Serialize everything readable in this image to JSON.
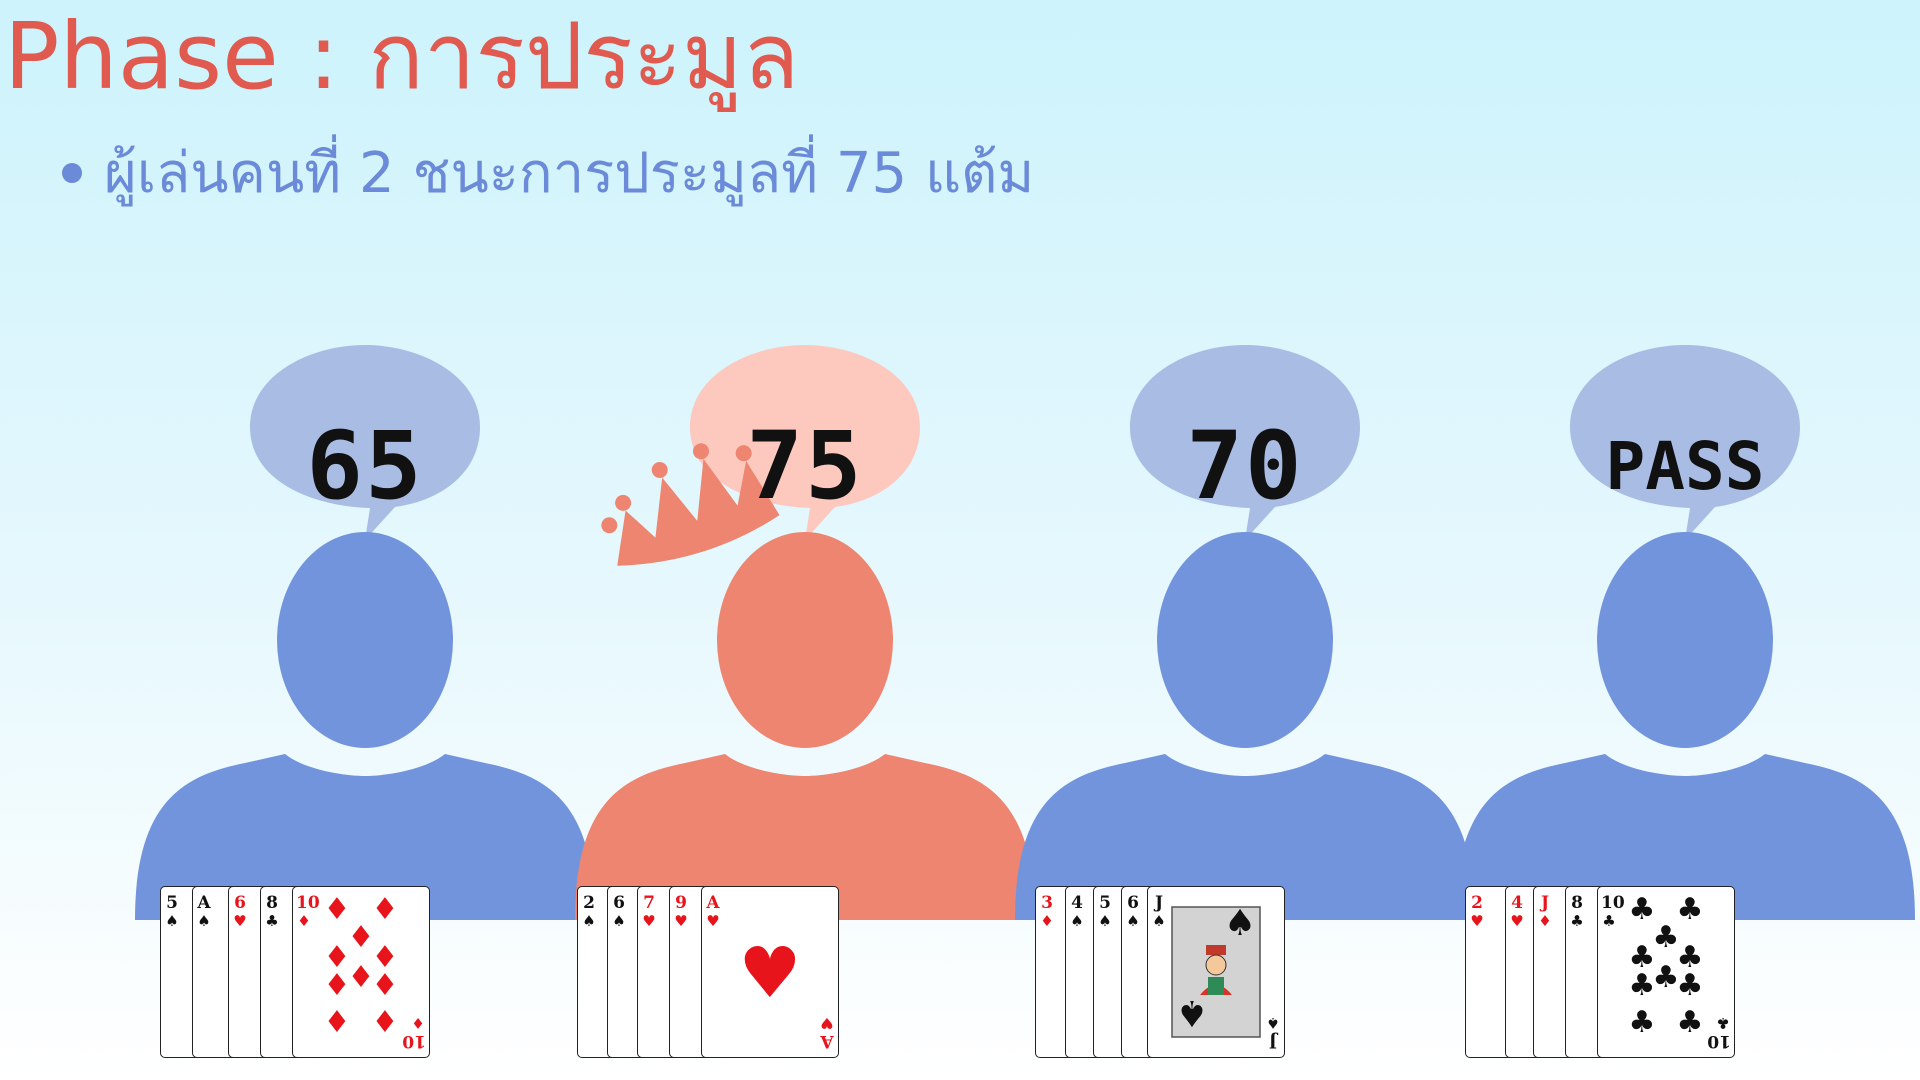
{
  "slide": {
    "title": "Phase : การประมูล",
    "bullet": "ผู้เล่นคนที่ 2 ชนะการประมูลที่ 75 แต้ม"
  },
  "colors": {
    "title": "#e05a4f",
    "bullet": "#6b8ad7",
    "player": "#7294dc",
    "winner": "#ee8570",
    "bubble": "#a9bce4",
    "winner_bubble": "#fdc9bf",
    "card_red": "#e8141c",
    "card_black": "#111111"
  },
  "players": [
    {
      "bid": "65",
      "winner": false,
      "cards": [
        {
          "rank": "5",
          "suit": "♠",
          "color": "black"
        },
        {
          "rank": "A",
          "suit": "♠",
          "color": "black"
        },
        {
          "rank": "6",
          "suit": "♥",
          "color": "red"
        },
        {
          "rank": "8",
          "suit": "♣",
          "color": "black"
        },
        {
          "rank": "10",
          "suit": "♦",
          "color": "red"
        }
      ]
    },
    {
      "bid": "75",
      "winner": true,
      "cards": [
        {
          "rank": "2",
          "suit": "♠",
          "color": "black"
        },
        {
          "rank": "6",
          "suit": "♠",
          "color": "black"
        },
        {
          "rank": "7",
          "suit": "♥",
          "color": "red"
        },
        {
          "rank": "9",
          "suit": "♥",
          "color": "red"
        },
        {
          "rank": "A",
          "suit": "♥",
          "color": "red"
        }
      ]
    },
    {
      "bid": "70",
      "winner": false,
      "cards": [
        {
          "rank": "3",
          "suit": "♦",
          "color": "red"
        },
        {
          "rank": "4",
          "suit": "♠",
          "color": "black"
        },
        {
          "rank": "5",
          "suit": "♠",
          "color": "black"
        },
        {
          "rank": "6",
          "suit": "♠",
          "color": "black"
        },
        {
          "rank": "J",
          "suit": "♠",
          "color": "black"
        }
      ]
    },
    {
      "bid": "PASS",
      "winner": false,
      "cards": [
        {
          "rank": "2",
          "suit": "♥",
          "color": "red"
        },
        {
          "rank": "4",
          "suit": "♥",
          "color": "red"
        },
        {
          "rank": "J",
          "suit": "♦",
          "color": "red"
        },
        {
          "rank": "8",
          "suit": "♣",
          "color": "black"
        },
        {
          "rank": "10",
          "suit": "♣",
          "color": "black"
        }
      ]
    }
  ]
}
